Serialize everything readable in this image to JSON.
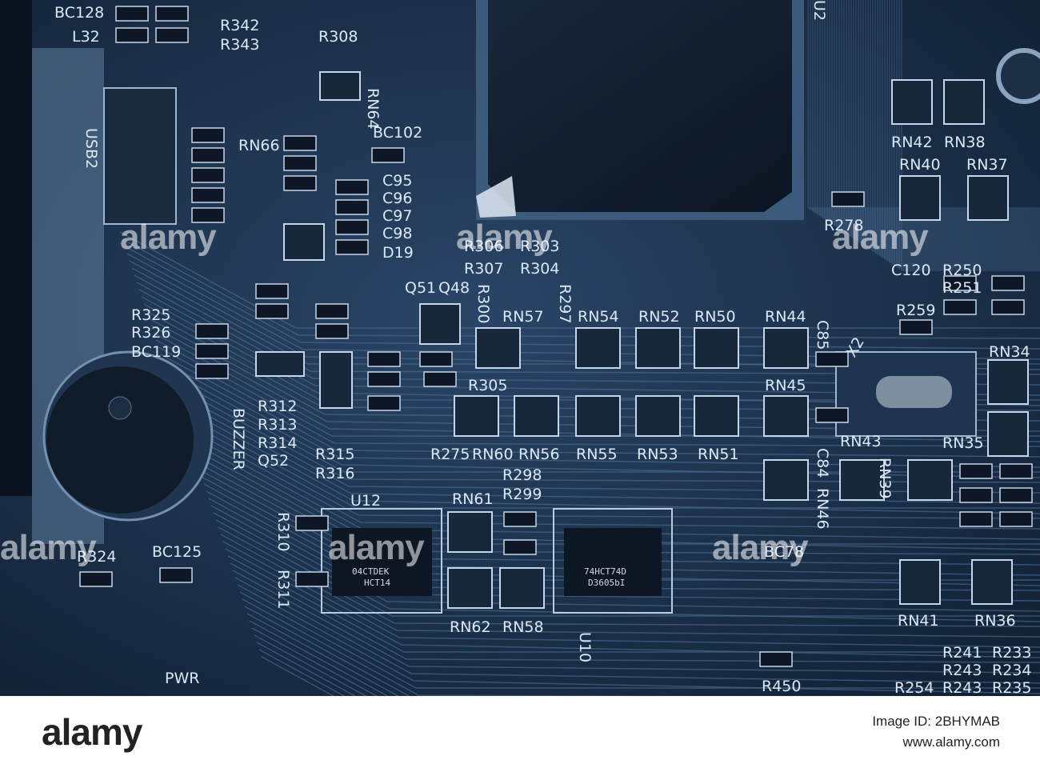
{
  "watermark": "alamy",
  "footer": {
    "logo": "alamy",
    "image_id": "Image ID: 2BHYMAB",
    "url": "www.alamy.com"
  },
  "silkscreen_labels": [
    "BC128",
    "L32",
    "R342",
    "R343",
    "R308",
    "RN64",
    "BC102",
    "RN66",
    "C95",
    "C96",
    "C97",
    "C98",
    "D19",
    "R306",
    "R303",
    "R307",
    "R304",
    "Q51",
    "Q48",
    "RN57",
    "RN54",
    "RN52",
    "RN50",
    "RN44",
    "R325",
    "R326",
    "BC119",
    "R305",
    "RN45",
    "R312",
    "R313",
    "R314",
    "Q52",
    "R315",
    "R316",
    "R275",
    "RN60",
    "RN56",
    "RN55",
    "RN53",
    "RN51",
    "R298",
    "R299",
    "U12",
    "RN61",
    "R324",
    "BC125",
    "RN62",
    "RN58",
    "U10",
    "BC78",
    "RN42",
    "RN38",
    "RN40",
    "RN37",
    "R278",
    "C120",
    "R250",
    "R251",
    "R259",
    "RN34",
    "RN35",
    "RN39",
    "RN41",
    "RN36",
    "R241",
    "R233",
    "R243",
    "R234",
    "R450",
    "R254",
    "R243",
    "R235",
    "USB2",
    "BUZZER",
    "X2",
    "C85",
    "C84",
    "RN46",
    "PWR",
    "R297",
    "R300",
    "RN43",
    "R310",
    "R311",
    "U2"
  ],
  "chip_markings": [
    "04CTDEK",
    "HCT14",
    "74HCT74D",
    "D3605bI"
  ],
  "colors": {
    "board": "#14263d",
    "trace": "#4d6f95",
    "silk": "#dbe8f6",
    "chip": "#0f1a29"
  }
}
